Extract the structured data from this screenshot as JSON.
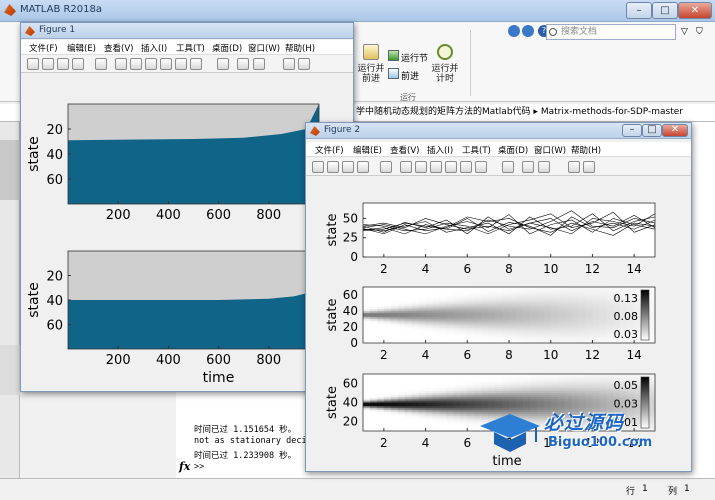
{
  "matlab": {
    "title": "MATLAB R2018a",
    "search_placeholder": "搜索文档",
    "ribbon": {
      "run_advance": "运行并\n前进",
      "run_section": "运行节",
      "advance": "前进",
      "run_time": "运行并\n计时",
      "run_group": "运行"
    },
    "path": {
      "folder1": "学中随机动态规划的矩阵方法的Matlab代码",
      "folder2": "Matrix-methods-for-SDP-master"
    },
    "command_window": {
      "lines": [
        "时间已过 1.151654 秒。",
        "not as stationary decis",
        "时间已过 1.233908 秒。"
      ],
      "prompt": ">>"
    },
    "status": {
      "row_label": "行",
      "row_value": "1",
      "col_label": "列",
      "col_value": "1"
    }
  },
  "figure1": {
    "title": "Figure 1",
    "menu": [
      "文件(F)",
      "编辑(E)",
      "查看(V)",
      "插入(I)",
      "工具(T)",
      "桌面(D)",
      "窗口(W)",
      "帮助(H)"
    ]
  },
  "figure2": {
    "title": "Figure 2",
    "menu": [
      "文件(F)",
      "编辑(E)",
      "查看(V)",
      "插入(I)",
      "工具(T)",
      "桌面(D)",
      "窗口(W)",
      "帮助(H)"
    ]
  },
  "chart_data": [
    {
      "type": "area",
      "figure": "Figure 1",
      "panel": "top",
      "ylabel": "state",
      "xlabel": "",
      "xticks": [
        200,
        400,
        600,
        800
      ],
      "yticks": [
        20,
        40,
        60
      ],
      "xlim": [
        0,
        1000
      ],
      "ylim": [
        0,
        80
      ],
      "y_reversed": true,
      "boundary": {
        "x": [
          0,
          500,
          700,
          850,
          950,
          1000
        ],
        "y": [
          29,
          28,
          27,
          24,
          20,
          0
        ]
      },
      "colors": {
        "fill": "#0f6488",
        "background": "#cfcfcf"
      }
    },
    {
      "type": "area",
      "figure": "Figure 1",
      "panel": "bottom",
      "ylabel": "state",
      "xlabel": "time",
      "xticks": [
        200,
        400,
        600,
        800
      ],
      "yticks": [
        20,
        40,
        60
      ],
      "xlim": [
        0,
        1000
      ],
      "ylim": [
        0,
        80
      ],
      "y_reversed": true,
      "boundary": {
        "x": [
          0,
          600,
          800,
          900,
          960,
          1000
        ],
        "y": [
          40,
          40,
          39,
          37,
          34,
          30
        ]
      },
      "colors": {
        "fill": "#0f6488",
        "background": "#cfcfcf"
      }
    },
    {
      "type": "line",
      "figure": "Figure 2",
      "panel": "top",
      "ylabel": "state",
      "xticks": [
        2,
        4,
        6,
        8,
        10,
        12,
        14
      ],
      "yticks": [
        0,
        25,
        50
      ],
      "xlim": [
        1,
        15
      ],
      "ylim": [
        0,
        70
      ],
      "series": [
        {
          "x": [
            1,
            2,
            3,
            4,
            5,
            6,
            7,
            8,
            9,
            10,
            11,
            12,
            13,
            14,
            15
          ],
          "y": [
            35,
            38,
            30,
            42,
            36,
            50,
            33,
            45,
            40,
            28,
            52,
            38,
            44,
            36,
            48
          ]
        },
        {
          "x": [
            1,
            2,
            3,
            4,
            5,
            6,
            7,
            8,
            9,
            10,
            11,
            12,
            13,
            14,
            15
          ],
          "y": [
            40,
            32,
            45,
            38,
            48,
            30,
            52,
            36,
            44,
            50,
            34,
            46,
            40,
            54,
            38
          ]
        },
        {
          "x": [
            1,
            2,
            3,
            4,
            5,
            6,
            7,
            8,
            9,
            10,
            11,
            12,
            13,
            14,
            15
          ],
          "y": [
            38,
            42,
            36,
            30,
            40,
            46,
            38,
            55,
            30,
            42,
            48,
            32,
            50,
            42,
            36
          ]
        },
        {
          "x": [
            1,
            2,
            3,
            4,
            5,
            6,
            7,
            8,
            9,
            10,
            11,
            12,
            13,
            14,
            15
          ],
          "y": [
            36,
            34,
            40,
            46,
            32,
            38,
            44,
            30,
            52,
            36,
            40,
            56,
            34,
            46,
            52
          ]
        },
        {
          "x": [
            1,
            2,
            3,
            4,
            5,
            6,
            7,
            8,
            9,
            10,
            11,
            12,
            13,
            14,
            15
          ],
          "y": [
            42,
            40,
            34,
            36,
            44,
            40,
            30,
            42,
            48,
            56,
            38,
            44,
            58,
            32,
            42
          ]
        },
        {
          "x": [
            1,
            2,
            3,
            4,
            5,
            6,
            7,
            8,
            9,
            10,
            11,
            12,
            13,
            14,
            15
          ],
          "y": [
            34,
            36,
            44,
            40,
            36,
            34,
            48,
            40,
            36,
            46,
            60,
            40,
            38,
            50,
            44
          ]
        },
        {
          "x": [
            1,
            2,
            3,
            4,
            5,
            6,
            7,
            8,
            9,
            10,
            11,
            12,
            13,
            14,
            15
          ],
          "y": [
            40,
            44,
            38,
            50,
            42,
            36,
            40,
            34,
            44,
            38,
            30,
            50,
            46,
            40,
            56
          ]
        },
        {
          "x": [
            1,
            2,
            3,
            4,
            5,
            6,
            7,
            8,
            9,
            10,
            11,
            12,
            13,
            14,
            15
          ],
          "y": [
            37,
            30,
            42,
            34,
            38,
            52,
            46,
            50,
            38,
            32,
            44,
            36,
            28,
            44,
            40
          ]
        }
      ]
    },
    {
      "type": "heatmap",
      "figure": "Figure 2",
      "panel": "middle",
      "ylabel": "state",
      "xticks": [
        2,
        4,
        6,
        8,
        10,
        12,
        14
      ],
      "yticks": [
        0,
        20,
        40,
        60
      ],
      "xlim": [
        1,
        15
      ],
      "ylim": [
        0,
        70
      ],
      "colorbar_ticks": [
        0.13,
        0.08,
        0.03
      ],
      "center_state": 35
    },
    {
      "type": "heatmap",
      "figure": "Figure 2",
      "panel": "bottom",
      "ylabel": "state",
      "xlabel": "time",
      "xticks": [
        2,
        4,
        6,
        8,
        10,
        12,
        14
      ],
      "yticks": [
        20,
        40,
        60
      ],
      "xlim": [
        1,
        15
      ],
      "ylim": [
        10,
        70
      ],
      "colorbar_ticks": [
        0.05,
        0.03,
        0.01
      ],
      "center_state": 38
    }
  ],
  "watermark": {
    "title": "必过源码",
    "url": "Biguo100.com"
  }
}
